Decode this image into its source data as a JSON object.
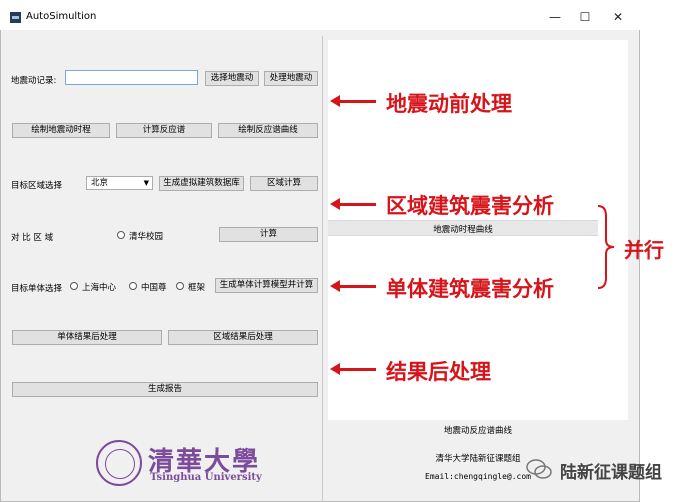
{
  "window": {
    "title": "AutoSimultion",
    "controls": [
      "—",
      "☐",
      "✕"
    ]
  },
  "earthquake": {
    "record_label": "地震动记录:",
    "record_value": "",
    "select_button": "选择地震动",
    "process_button": "处理地震动",
    "plot_history_button": "绘制地震动时程",
    "calc_spectrum_button": "计算反应谱",
    "plot_spectrum_button": "绘制反应谱曲线"
  },
  "region": {
    "label": "目标区域选择",
    "selected": "北京",
    "build_db_button": "生成虚拟建筑数据库",
    "calc_button": "区域计算"
  },
  "compare": {
    "label": "对 比 区 域",
    "option": "清华校园",
    "calc_button": "计算"
  },
  "single": {
    "label": "目标单体选择",
    "options": [
      "上海中心",
      "中国尊",
      "框架"
    ],
    "calc_button": "生成单体计算模型并计算"
  },
  "post": {
    "single_button": "单体结果后处理",
    "region_button": "区域结果后处理",
    "report_button": "生成报告"
  },
  "panel": {
    "history_caption": "地震动时程曲线",
    "spectrum_caption": "地震动反应谱曲线",
    "group_name": "清华大学陆新征课题组",
    "email": "Email:chengqingle@.com"
  },
  "logo": {
    "cn": "清華大學",
    "en": "Tsinghua University"
  },
  "annotations": {
    "pre": "地震动前处理",
    "region": "区域建筑震害分析",
    "single": "单体建筑震害分析",
    "post": "结果后处理",
    "parallel": "并行"
  },
  "watermark": "陆新征课题组",
  "colors": {
    "annotation": "#d6141a",
    "logo": "#7c4b9b"
  }
}
